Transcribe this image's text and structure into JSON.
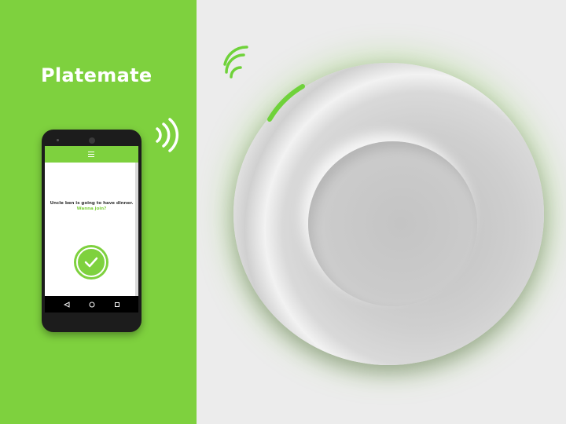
{
  "brand": {
    "title": "Platemate"
  },
  "phone": {
    "message_line1": "Uncle ben is going to have dinner.",
    "message_line2": "Wanna join?",
    "icons": {
      "menu": "menu-icon",
      "confirm": "checkmark-icon",
      "back": "back-triangle-icon",
      "home": "home-circle-icon",
      "recents": "recents-square-icon"
    }
  },
  "colors": {
    "brand_green": "#7ed13e",
    "background_light": "#ececec"
  }
}
